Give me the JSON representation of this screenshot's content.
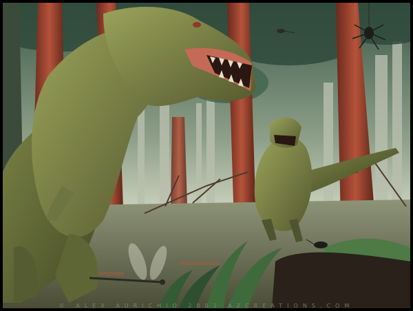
{
  "artwork": {
    "caption": "© ALEX AURICHIO 2001 AZCREATIONS.COM",
    "palette": {
      "fog": "#cfd6c2",
      "canopy": "#4d6b57",
      "trunk": "#a4452f",
      "swamp": "#6b6e54",
      "dino_skin": "#7f8a4a",
      "dino_shadow": "#4e5430",
      "mouth": "#c46a56",
      "fern": "#3f6a3c"
    }
  }
}
